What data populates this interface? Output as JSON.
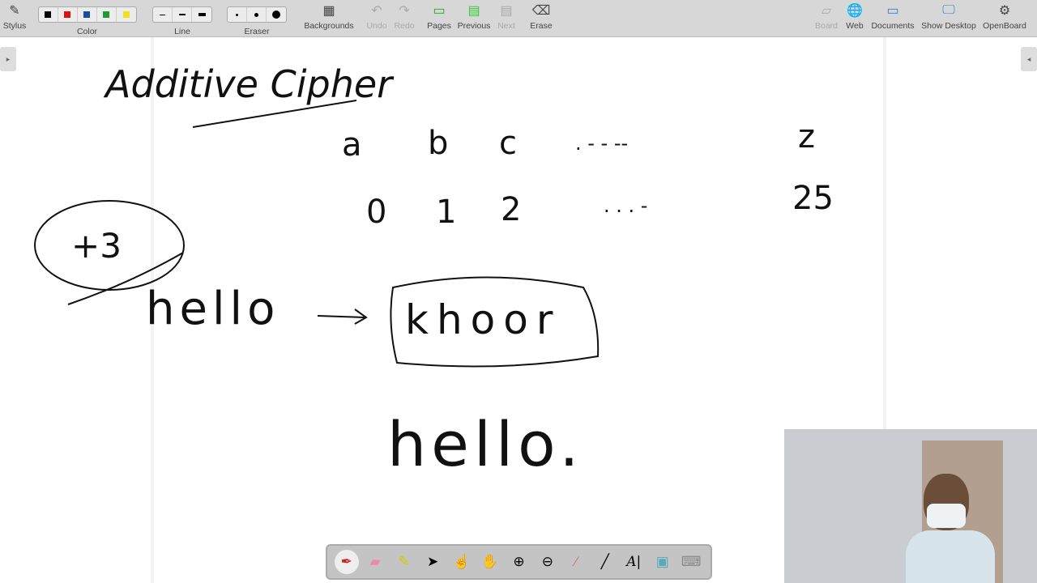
{
  "toolbar": {
    "stylus": "Stylus",
    "color": "Color",
    "line": "Line",
    "eraser": "Eraser",
    "backgrounds": "Backgrounds",
    "undo": "Undo",
    "redo": "Redo",
    "pages": "Pages",
    "previous": "Previous",
    "next": "Next",
    "erase": "Erase",
    "board": "Board",
    "web": "Web",
    "documents": "Documents",
    "show_desktop": "Show Desktop",
    "openboard": "OpenBoard",
    "colors": [
      "#000000",
      "#e01010",
      "#1a4fa0",
      "#1c9c2c",
      "#f0e020"
    ]
  },
  "board": {
    "title": "Additive Cipher",
    "letters": [
      "a",
      "b",
      "c",
      ".  -  -  --",
      "z"
    ],
    "numbers": [
      "0",
      "1",
      "2",
      ".  .  .  -",
      "25"
    ],
    "shift": "+3",
    "plain": "hello",
    "arrow": "→",
    "cipher": "khoor",
    "plain2": "hello."
  },
  "dock": [
    "pen-tool",
    "eraser-tool",
    "highlighter-tool",
    "selector-tool",
    "interact-tool",
    "hand-tool",
    "zoom-in-tool",
    "zoom-out-tool",
    "laser-pointer-tool",
    "line-tool",
    "text-tool",
    "capture-tool",
    "keyboard-tool"
  ]
}
